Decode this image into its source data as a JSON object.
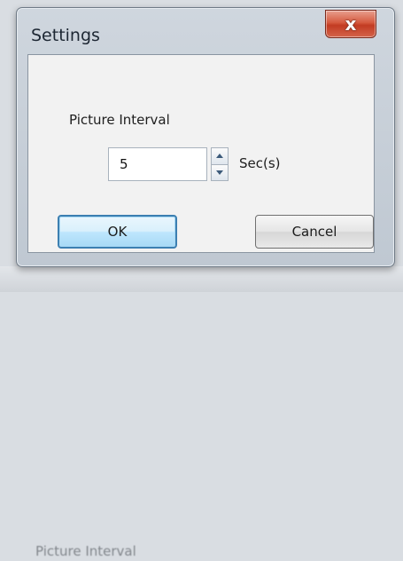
{
  "background": {
    "text": "Picture Interval"
  },
  "window": {
    "title": "Settings",
    "close_label": "x"
  },
  "form": {
    "interval_label": "Picture Interval",
    "interval_value": "5",
    "unit_label": "Sec(s)"
  },
  "buttons": {
    "ok_label": "OK",
    "cancel_label": "Cancel"
  },
  "colors": {
    "close_button": "#c23b22",
    "focus_border": "#3c7fb1"
  },
  "icons": {
    "spin_up": "chevron-up-icon",
    "spin_down": "chevron-down-icon"
  }
}
